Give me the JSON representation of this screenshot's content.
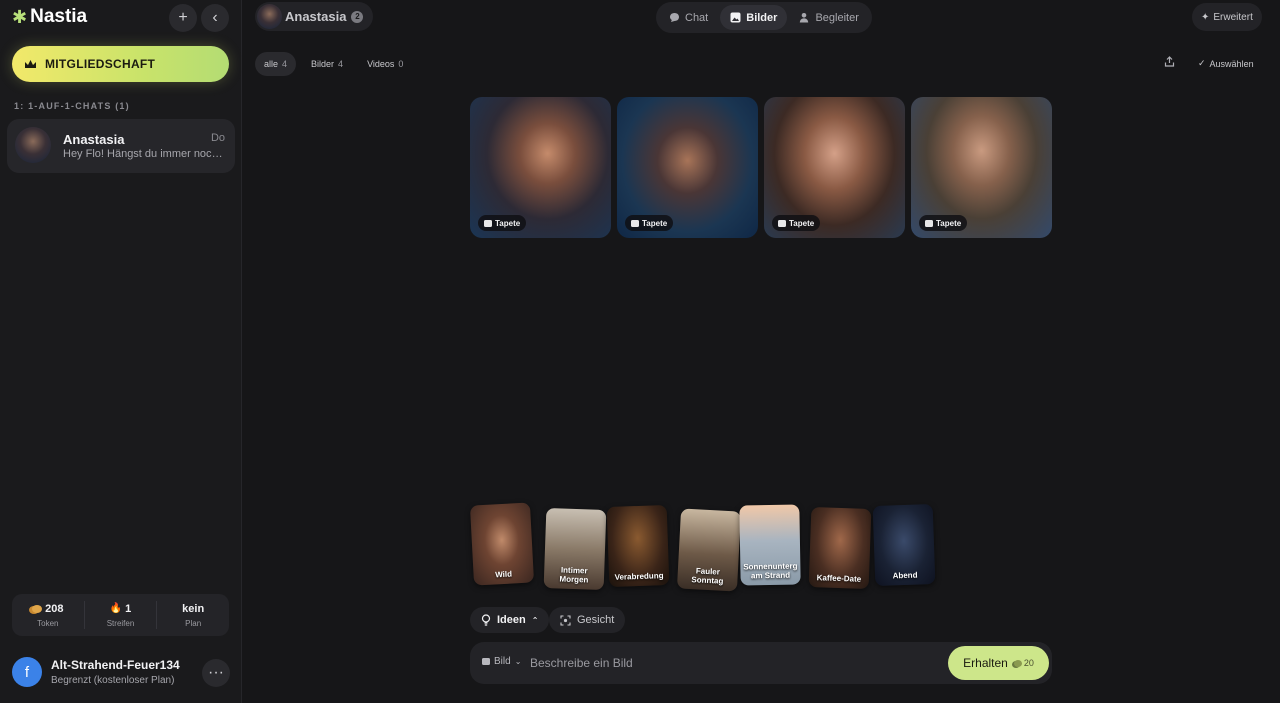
{
  "sidebar": {
    "logo": "Nastia",
    "membership_label": "MITGLIEDSCHAFT",
    "section_label": "1: 1-AUF-1-CHATS (1)",
    "chats": [
      {
        "name": "Anastasia",
        "time": "Do",
        "preview": "Hey Flo! Hängst du immer noch ..."
      }
    ],
    "stats": [
      {
        "value": "208",
        "label": "Token",
        "icon": "coin-icon"
      },
      {
        "value": "1",
        "label": "Streifen",
        "icon": "flame-icon"
      },
      {
        "value": "kein",
        "label": "Plan",
        "icon": ""
      }
    ],
    "user": {
      "initial": "f",
      "name": "Alt-Strahend-Feuer134",
      "plan": "Begrenzt (kostenloser Plan)"
    }
  },
  "header": {
    "companion": {
      "name": "Anastasia",
      "badge": "2"
    },
    "tabs": [
      {
        "label": "Chat",
        "icon": "chat-bubble-icon",
        "active": false
      },
      {
        "label": "Bilder",
        "icon": "image-icon",
        "active": true
      },
      {
        "label": "Begleiter",
        "icon": "person-icon",
        "active": false
      }
    ],
    "extended_label": "Erweitert"
  },
  "filters": [
    {
      "label": "alle",
      "count": "4",
      "active": true
    },
    {
      "label": "Bilder",
      "count": "4",
      "active": false
    },
    {
      "label": "Videos",
      "count": "0",
      "active": false
    }
  ],
  "select_label": "Auswählen",
  "gallery": [
    {
      "tag": "Tapete"
    },
    {
      "tag": "Tapete"
    },
    {
      "tag": "Tapete"
    },
    {
      "tag": "Tapete"
    }
  ],
  "ideas": [
    {
      "line1": "Wild",
      "line2": ""
    },
    {
      "line1": "Intimer",
      "line2": "Morgen"
    },
    {
      "line1": "Verabredung",
      "line2": ""
    },
    {
      "line1": "Fauler",
      "line2": "Sonntag"
    },
    {
      "line1": "Sonnenunterg",
      "line2": "am Strand"
    },
    {
      "line1": "Kaffee-Date",
      "line2": ""
    },
    {
      "line1": "Abend",
      "line2": ""
    }
  ],
  "controls": {
    "ideas_label": "Ideen",
    "face_label": "Gesicht",
    "type_label": "Bild",
    "prompt_placeholder": "Beschreibe ein Bild",
    "get_label": "Erhalten",
    "cost": "20"
  },
  "colors": {
    "background": "#161618",
    "sidebar": "#1a1a1c",
    "accent": "#cde68a",
    "membership_gradient_start": "#f2e96a"
  }
}
